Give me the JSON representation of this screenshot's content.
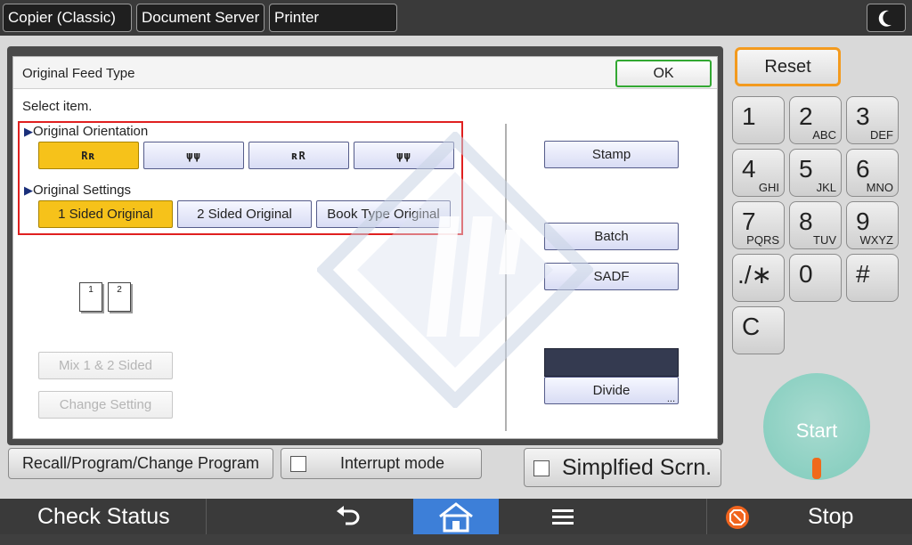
{
  "tabs": [
    {
      "label": "Copier (Classic)"
    },
    {
      "label": "Document Server"
    },
    {
      "label": "Printer"
    }
  ],
  "dialog": {
    "title": "Original Feed Type",
    "ok_label": "OK",
    "select_prompt": "Select item.",
    "orientation": {
      "label": "Original Orientation",
      "options": [
        {
          "icon": "Rʀ",
          "selected": true
        },
        {
          "icon": "ψψ",
          "selected": false
        },
        {
          "icon": "ʀR",
          "selected": false
        },
        {
          "icon": "ψψ",
          "selected": false
        }
      ]
    },
    "settings": {
      "label": "Original Settings",
      "options": [
        {
          "label": "1 Sided Original",
          "selected": true
        },
        {
          "label": "2 Sided Original",
          "selected": false
        },
        {
          "label": "Book Type Original",
          "selected": false
        }
      ]
    },
    "pages": [
      "1",
      "2"
    ],
    "mix_label": "Mix 1 & 2 Sided",
    "change_label": "Change Setting",
    "right_buttons": {
      "stamp": "Stamp",
      "batch": "Batch",
      "sadf": "SADF",
      "divide": "Divide",
      "divide_more": "..."
    }
  },
  "lower": {
    "recall_label": "Recall/Program/Change Program",
    "interrupt_label": "Interrupt mode",
    "simplified_label": "Simplfied Scrn."
  },
  "keypad": {
    "reset_label": "Reset",
    "keys": [
      {
        "main": "1",
        "sub": ""
      },
      {
        "main": "2",
        "sub": "ABC"
      },
      {
        "main": "3",
        "sub": "DEF"
      },
      {
        "main": "4",
        "sub": "GHI"
      },
      {
        "main": "5",
        "sub": "JKL"
      },
      {
        "main": "6",
        "sub": "MNO"
      },
      {
        "main": "7",
        "sub": "PQRS"
      },
      {
        "main": "8",
        "sub": "TUV"
      },
      {
        "main": "9",
        "sub": "WXYZ"
      },
      {
        "main": "./∗",
        "sub": ""
      },
      {
        "main": "0",
        "sub": ""
      },
      {
        "main": "#",
        "sub": ""
      },
      {
        "main": "C",
        "sub": ""
      }
    ],
    "start_label": "Start"
  },
  "statusbar": {
    "check_status_label": "Check Status",
    "stop_label": "Stop"
  },
  "colors": {
    "selected": "#f6c21a",
    "highlight_box": "#e02020",
    "home": "#3d7fd8",
    "start": "#7fcbbb",
    "reset_border": "#f39a1e"
  }
}
